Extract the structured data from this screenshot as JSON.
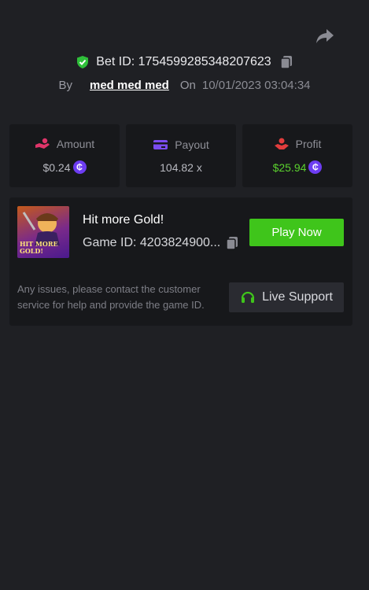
{
  "share": {
    "icon": "share-icon"
  },
  "bet": {
    "id_text": "Bet ID: 1754599285348207623",
    "by_label": "By",
    "user": "med med med",
    "on_label": "On",
    "date": "10/01/2023 03:04:34"
  },
  "stats": {
    "amount": {
      "label": "Amount",
      "value": "$0.24",
      "icon": "hand-coins-icon",
      "currency_symbol": "₵"
    },
    "payout": {
      "label": "Payout",
      "value": "104.82 x",
      "icon": "card-icon"
    },
    "profit": {
      "label": "Profit",
      "value": "$25.94",
      "icon": "hand-gift-icon",
      "currency_symbol": "₵"
    }
  },
  "game": {
    "title": "Hit more Gold!",
    "id_text": "Game ID: 4203824900...",
    "thumbnail_text": "HIT MORE GOLD!",
    "play_label": "Play Now",
    "help_text": "Any issues, please contact the customer service for help and provide the game ID.",
    "support_label": "Live Support"
  },
  "colors": {
    "background": "#1f2024",
    "card": "#17181b",
    "accent_green": "#3fc51b",
    "profit_green": "#5bd12e",
    "coin_purple": "#6d3cf2",
    "shield_green": "#2fbf3a",
    "amount_pink": "#e0356a",
    "payout_purple": "#7b4cf0",
    "profit_red": "#e23d3d"
  }
}
